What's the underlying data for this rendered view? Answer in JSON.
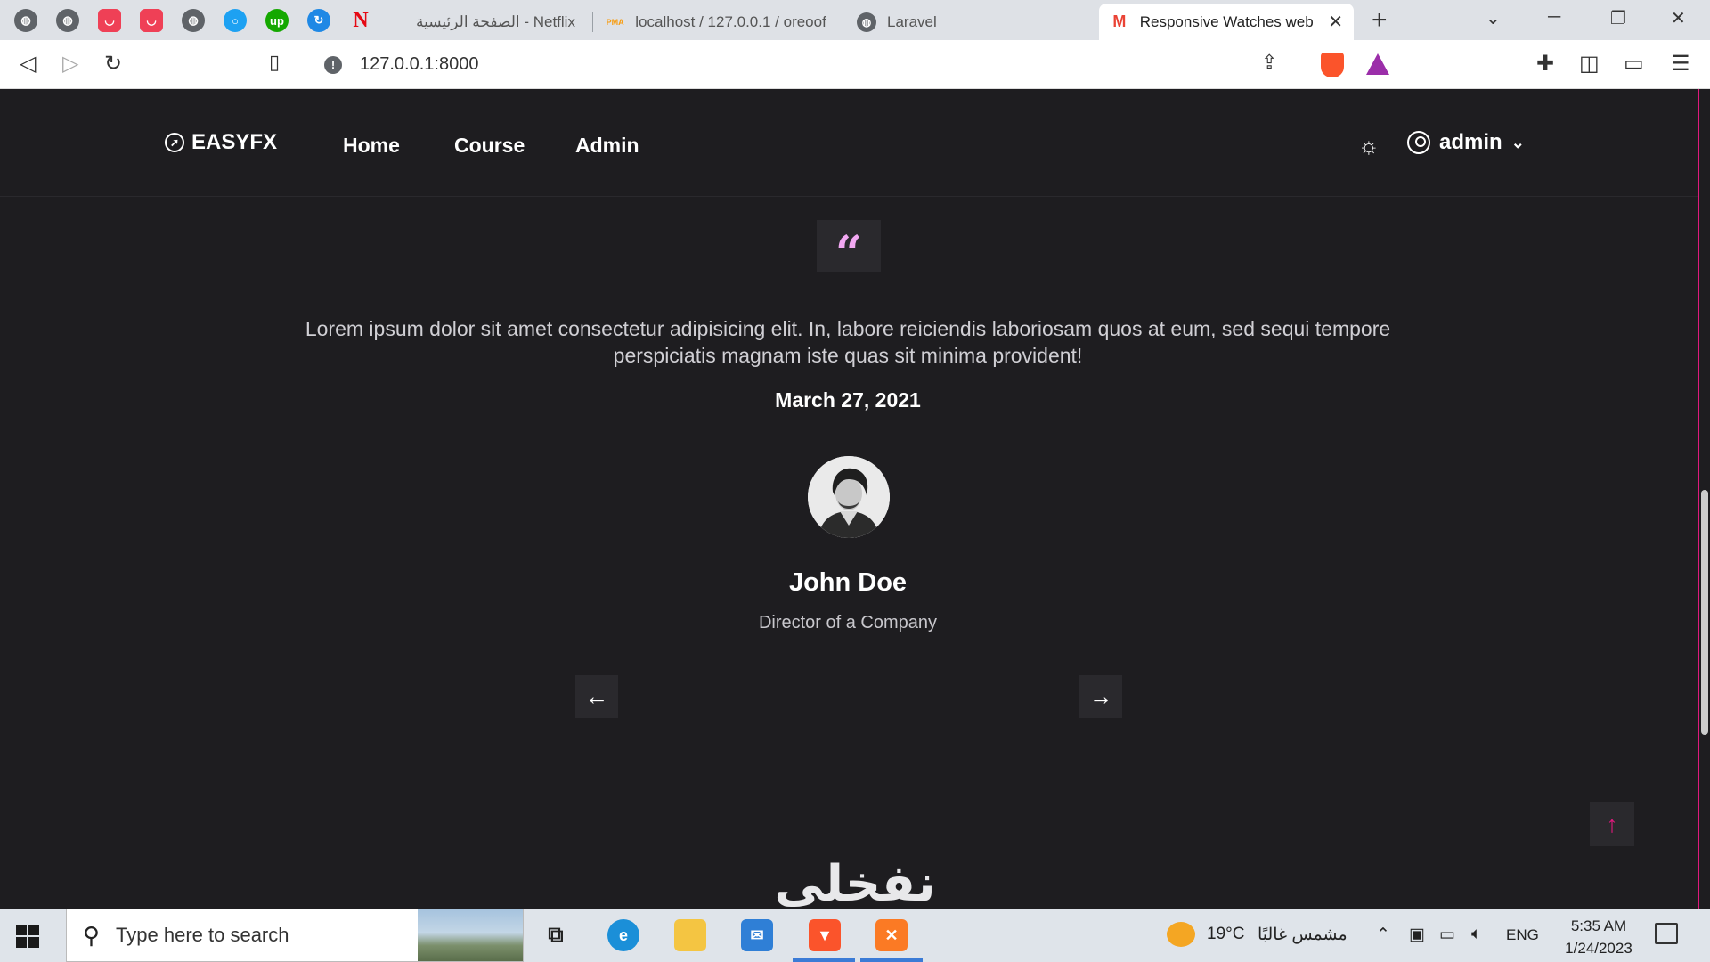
{
  "browser": {
    "pinned_tabs": [
      {
        "icon": "globe-icon",
        "color": "#5f6368"
      },
      {
        "icon": "globe-icon",
        "color": "#5f6368"
      },
      {
        "icon": "pocket-icon",
        "color": "#ef4056"
      },
      {
        "icon": "pocket-icon",
        "color": "#ef4056"
      },
      {
        "icon": "globe-icon",
        "color": "#5f6368"
      },
      {
        "icon": "circle-icon",
        "color": "#1da1f2"
      },
      {
        "icon": "upwork-icon",
        "color": "#14a800",
        "label": "up"
      },
      {
        "icon": "swirl-icon",
        "color": "#1e88e5"
      },
      {
        "icon": "netflix-icon",
        "color": "#e50914",
        "label": "N"
      }
    ],
    "tabs": [
      {
        "title": "Netflix - الصفحة الرئيسية",
        "active": false
      },
      {
        "title": "localhost / 127.0.0.1 / oreoof",
        "active": false,
        "icon_label": "PMA"
      },
      {
        "title": "Laravel",
        "active": false
      },
      {
        "title": "Responsive Watches web",
        "active": true
      }
    ],
    "url": "127.0.0.1:8000"
  },
  "site": {
    "brand": "EASYFX",
    "nav": [
      "Home",
      "Course",
      "Admin"
    ],
    "user": "admin"
  },
  "testimonial": {
    "quote_mark": "“",
    "text": "Lorem ipsum dolor sit amet consectetur adipisicing elit. In, labore reiciendis laboriosam quos at eum, sed sequi tempore perspiciatis magnam iste quas sit minima provident!",
    "date": "March 27, 2021",
    "name": "John Doe",
    "role": "Director of a Company"
  },
  "watermark": "نفخلي",
  "taskbar": {
    "search_placeholder": "Type here to search",
    "weather_temp": "19°C",
    "weather_text": "مشمس غالبًا",
    "language": "ENG",
    "time": "5:35 AM",
    "date": "1/24/2023"
  },
  "colors": {
    "page_bg": "#1e1d20",
    "accent_pink": "#e0197d",
    "quote_pink": "#f2a8f2"
  }
}
